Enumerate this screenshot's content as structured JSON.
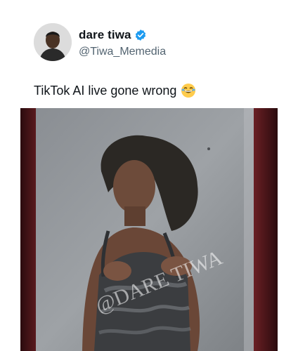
{
  "tweet": {
    "author": {
      "display_name": "dare tiwa",
      "handle": "@Tiwa_Memedia",
      "verified": true,
      "avatar_icon": "profile-photo"
    },
    "text": "TikTok AI live gone wrong",
    "emoji": "rolling-on-floor-laughing-emoji"
  },
  "media": {
    "type": "video-still",
    "watermark": "@DARE TIWA"
  },
  "colors": {
    "verified_blue": "#1d9bf0",
    "handle_gray": "#536471",
    "text": "#0f1419",
    "media_frame": "#3a0f12"
  }
}
